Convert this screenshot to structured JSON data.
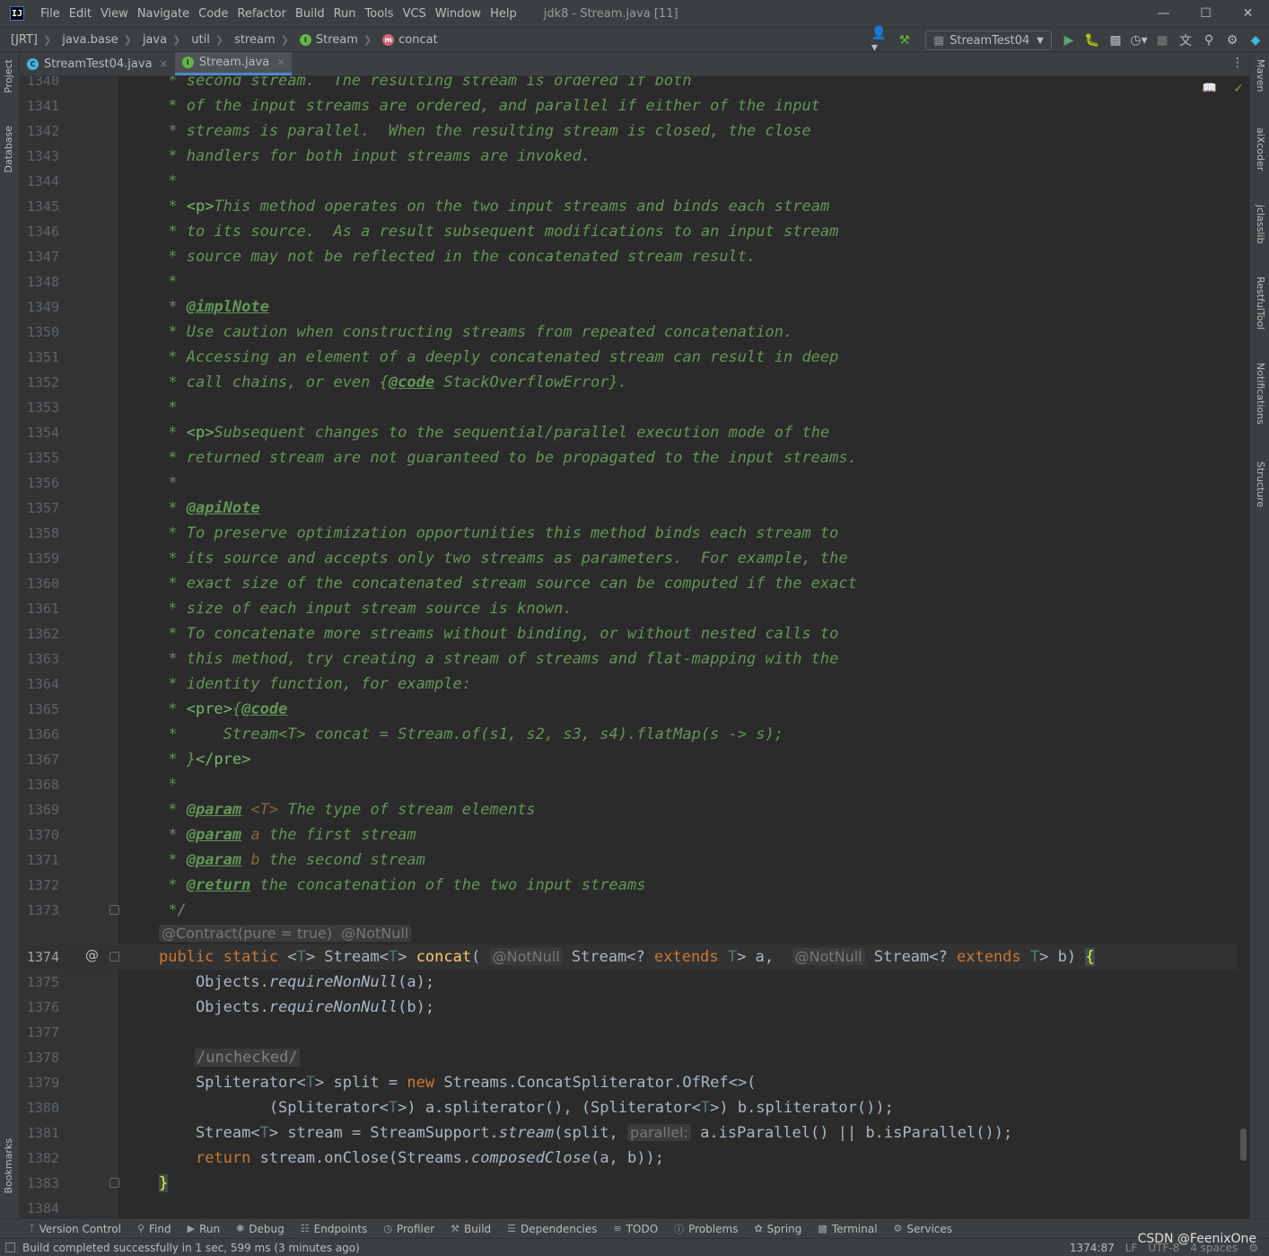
{
  "titlebar": {
    "logo": "IJ",
    "menu": [
      "File",
      "Edit",
      "View",
      "Navigate",
      "Code",
      "Refactor",
      "Build",
      "Run",
      "Tools",
      "VCS",
      "Window",
      "Help"
    ],
    "window_title": "jdk8 - Stream.java [11]"
  },
  "navbar": {
    "crumbs": [
      "[JRT]",
      "java.base",
      "java",
      "util",
      "stream",
      "Stream",
      "concat"
    ],
    "run_config": "StreamTest04"
  },
  "left_strip": {
    "project": "Project",
    "database": "Database",
    "bookmarks": "Bookmarks"
  },
  "right_strip": {
    "maven": "Maven",
    "aixcoder": "aiXcoder",
    "jclasslib": "jclasslib",
    "restful": "RestfulTool",
    "notifications": "Notifications",
    "structure": "Structure"
  },
  "tabs": [
    {
      "label": "StreamTest04.java",
      "active": false
    },
    {
      "label": "Stream.java",
      "active": true
    }
  ],
  "code": {
    "l1340": "1340",
    "t1340": " * second stream.  The resulting stream is ordered if both",
    "l1341": "1341",
    "t1341": " * of the input streams are ordered, and parallel if either of the input",
    "l1342": "1342",
    "t1342": " * streams is parallel.  When the resulting stream is closed, the close",
    "l1343": "1343",
    "t1343": " * handlers for both input streams are invoked.",
    "l1344": "1344",
    "t1344": " *",
    "l1345": "1345",
    "t1345a": " * ",
    "t1345b": "<p>",
    "t1345c": "This method operates on the two input streams and binds each stream",
    "l1346": "1346",
    "t1346": " * to its source.  As a result subsequent modifications to an input stream",
    "l1347": "1347",
    "t1347": " * source may not be reflected in the concatenated stream result.",
    "l1348": "1348",
    "t1348": " *",
    "l1349": "1349",
    "t1349a": " * ",
    "t1349b": "@implNote",
    "l1350": "1350",
    "t1350": " * Use caution when constructing streams from repeated concatenation.",
    "l1351": "1351",
    "t1351": " * Accessing an element of a deeply concatenated stream can result in deep",
    "l1352": "1352",
    "t1352a": " * call chains, or even {",
    "t1352b": "@code",
    "t1352c": " StackOverflowError}.",
    "l1353": "1353",
    "t1353": " *",
    "l1354": "1354",
    "t1354a": " * ",
    "t1354b": "<p>",
    "t1354c": "Subsequent changes to the sequential/parallel execution mode of the",
    "l1355": "1355",
    "t1355": " * returned stream are not guaranteed to be propagated to the input streams.",
    "l1356": "1356",
    "t1356": " *",
    "l1357": "1357",
    "t1357a": " * ",
    "t1357b": "@apiNote",
    "l1358": "1358",
    "t1358": " * To preserve optimization opportunities this method binds each stream to",
    "l1359": "1359",
    "t1359": " * its source and accepts only two streams as parameters.  For example, the",
    "l1360": "1360",
    "t1360": " * exact size of the concatenated stream source can be computed if the exact",
    "l1361": "1361",
    "t1361": " * size of each input stream source is known.",
    "l1362": "1362",
    "t1362": " * To concatenate more streams without binding, or without nested calls to",
    "l1363": "1363",
    "t1363": " * this method, try creating a stream of streams and flat-mapping with the",
    "l1364": "1364",
    "t1364": " * identity function, for example:",
    "l1365": "1365",
    "t1365a": " * ",
    "t1365b": "<pre>",
    "t1365c": "{",
    "t1365d": "@code",
    "l1366": "1366",
    "t1366": " *     Stream<T> concat = Stream.of(s1, s2, s3, s4).flatMap(s -> s);",
    "l1367": "1367",
    "t1367a": " * }",
    "t1367b": "</pre>",
    "l1368": "1368",
    "t1368": " *",
    "l1369": "1369",
    "t1369a": " * ",
    "t1369b": "@param",
    "t1369c": " <T>",
    "t1369d": " The type of stream elements",
    "l1370": "1370",
    "t1370a": " * ",
    "t1370b": "@param",
    "t1370c": " a",
    "t1370d": " the first stream",
    "l1371": "1371",
    "t1371a": " * ",
    "t1371b": "@param",
    "t1371c": " b",
    "t1371d": " the second stream",
    "l1372": "1372",
    "t1372a": " * ",
    "t1372b": "@return",
    "t1372c": " the concatenation of the two input streams",
    "l1373": "1373",
    "t1373": " */",
    "annotation_hint": "@Contract(pure = true)  @NotNull",
    "l1374": "1374",
    "t1374": {
      "kw1": "public",
      "kw2": "static",
      "tparam_open": " <",
      "tparam": "T",
      "tparam_close": "> Stream<",
      "t2": "T",
      "t3": "> ",
      "name": "concat",
      "paren": "(",
      "hint1": "@NotNull",
      "p1a": " Stream<? ",
      "ext1": "extends",
      "p1b": " ",
      "t4": "T",
      "p1c": "> a, ",
      "hint2": "@NotNull",
      "p2a": " Stream<? ",
      "ext2": "extends",
      "p2b": " ",
      "t5": "T",
      "p2c": "> b) ",
      "brace": "{"
    },
    "l1375": "1375",
    "t1375a": "    Objects.",
    "t1375b": "requireNonNull",
    "t1375c": "(a);",
    "l1376": "1376",
    "t1376a": "    Objects.",
    "t1376b": "requireNonNull",
    "t1376c": "(b);",
    "l1377": "1377",
    "l1378": "1378",
    "t1378": "/unchecked/",
    "l1379": "1379",
    "t1379a": "    Spliterator<",
    "t1379b": "T",
    "t1379c": "> split = ",
    "t1379d": "new",
    "t1379e": " Streams.ConcatSpliterator.OfRef<>(",
    "l1380": "1380",
    "t1380a": "            (Spliterator<",
    "t1380b": "T",
    "t1380c": ">) a.spliterator(), (Spliterator<",
    "t1380d": "T",
    "t1380e": ">) b.spliterator());",
    "l1381": "1381",
    "t1381a": "    Stream<",
    "t1381b": "T",
    "t1381c": "> stream = StreamSupport.",
    "t1381d": "stream",
    "t1381e": "(split, ",
    "t1381hint": "parallel:",
    "t1381f": " a.isParallel() || b.isParallel());",
    "l1382": "1382",
    "t1382a": "    ",
    "t1382b": "return",
    "t1382c": " stream.onClose(Streams.",
    "t1382d": "composedClose",
    "t1382e": "(a, b));",
    "l1383": "1383",
    "t1383": "}",
    "l1384": "1384"
  },
  "bottom_tabs": [
    "Version Control",
    "Find",
    "Run",
    "Debug",
    "Endpoints",
    "Profiler",
    "Build",
    "Dependencies",
    "TODO",
    "Problems",
    "Spring",
    "Terminal",
    "Services"
  ],
  "status": {
    "message": "Build completed successfully in 1 sec, 599 ms (3 minutes ago)",
    "position": "1374:87",
    "line_sep": "LF",
    "encoding": "UTF-8",
    "indent": "4 spaces",
    "watermark": "CSDN @FeenixOne"
  }
}
